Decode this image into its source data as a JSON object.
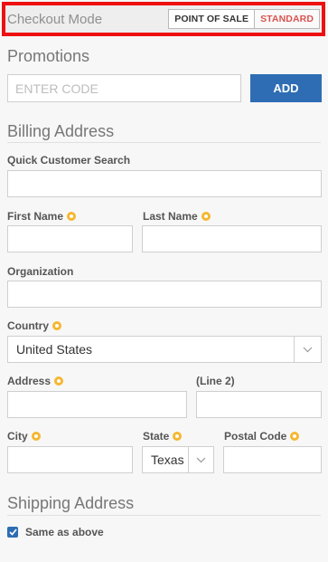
{
  "checkout": {
    "label": "Checkout Mode",
    "modes": [
      "POINT OF SALE",
      "STANDARD"
    ],
    "selected": "STANDARD"
  },
  "promotions": {
    "title": "Promotions",
    "placeholder": "ENTER CODE",
    "add_label": "ADD"
  },
  "billing": {
    "title": "Billing Address",
    "quick_search_label": "Quick Customer Search",
    "first_name_label": "First Name",
    "last_name_label": "Last Name",
    "organization_label": "Organization",
    "country_label": "Country",
    "country_value": "United States",
    "address_label": "Address",
    "line2_label": "(Line 2)",
    "city_label": "City",
    "state_label": "State",
    "state_value": "Texas",
    "postal_label": "Postal Code"
  },
  "shipping": {
    "title": "Shipping Address",
    "same_as_above_label": "Same as above",
    "same_as_above_checked": true
  },
  "colors": {
    "accent": "#2e6db4",
    "required": "#f5b730",
    "highlight": "#ee1111",
    "standard_text": "#d9534f"
  },
  "icons": {
    "required": "required-icon",
    "select_arrow": "chevron-down-icon",
    "check": "check-icon"
  }
}
